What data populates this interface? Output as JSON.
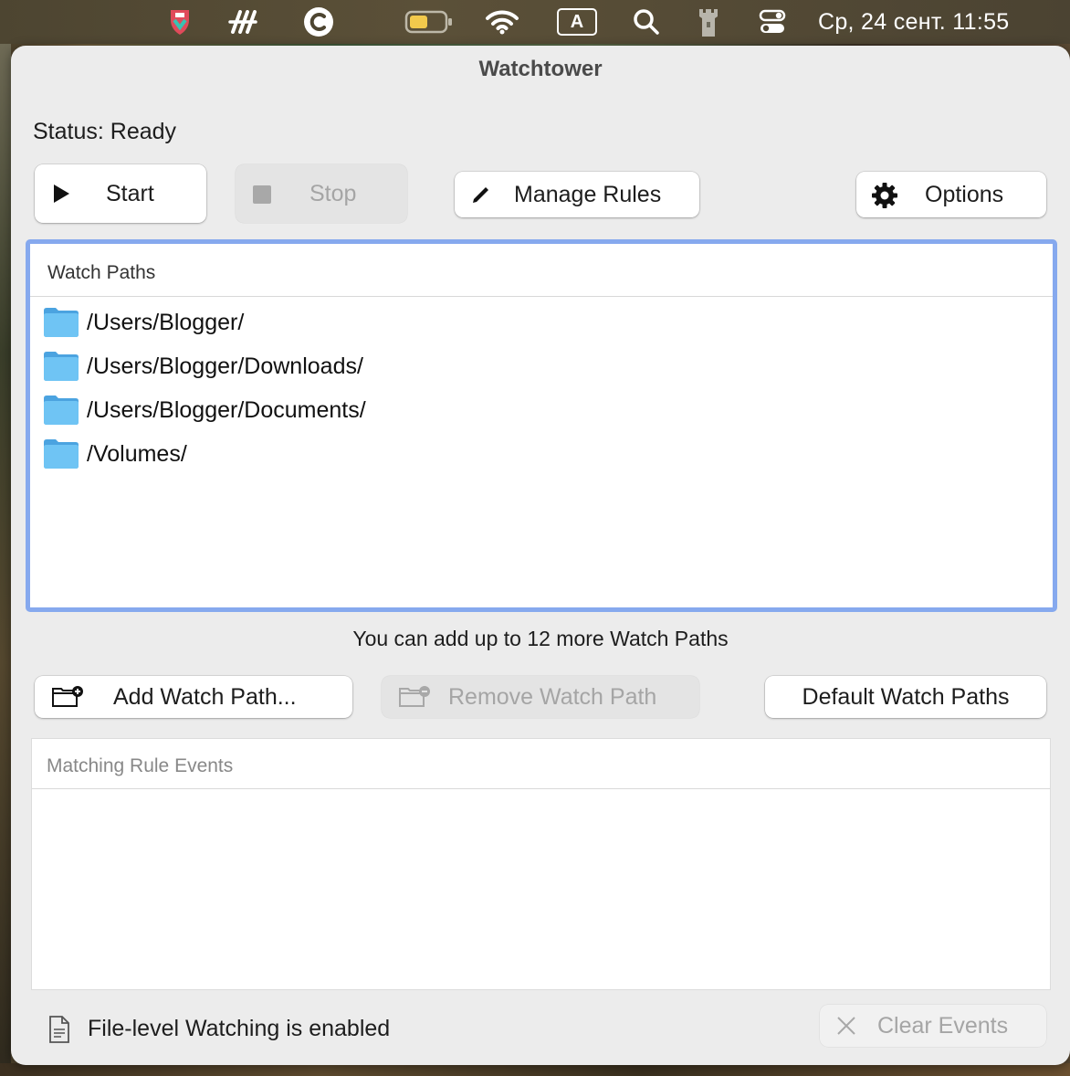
{
  "menubar": {
    "icons": [
      "shield-app-icon",
      "stripes-app-icon",
      "c-circle-app-icon",
      "battery-icon",
      "wifi-icon",
      "input-source-icon",
      "spotlight-search-icon",
      "tower-app-icon",
      "control-center-icon"
    ],
    "input_source_label": "A",
    "clock": "Ср, 24 сент.  11:55",
    "battery_color": "#f2c94c"
  },
  "window": {
    "title": "Watchtower",
    "status": "Status: Ready"
  },
  "toolbar": {
    "start_label": "Start",
    "stop_label": "Stop",
    "manage_rules_label": "Manage Rules",
    "options_label": "Options"
  },
  "watch_paths": {
    "header": "Watch Paths",
    "items": [
      "/Users/Blogger/",
      "/Users/Blogger/Downloads/",
      "/Users/Blogger/Documents/",
      "/Volumes/"
    ],
    "folder_color": "#5ab5ef",
    "focus_color": "#86a9ee"
  },
  "hint": "You can add up to 12 more Watch Paths",
  "path_actions": {
    "add_label": "Add Watch Path...",
    "remove_label": "Remove Watch Path",
    "default_label": "Default Watch Paths"
  },
  "events": {
    "header": "Matching Rule Events"
  },
  "footer": {
    "status": "File-level Watching is enabled",
    "clear_label": "Clear Events"
  }
}
